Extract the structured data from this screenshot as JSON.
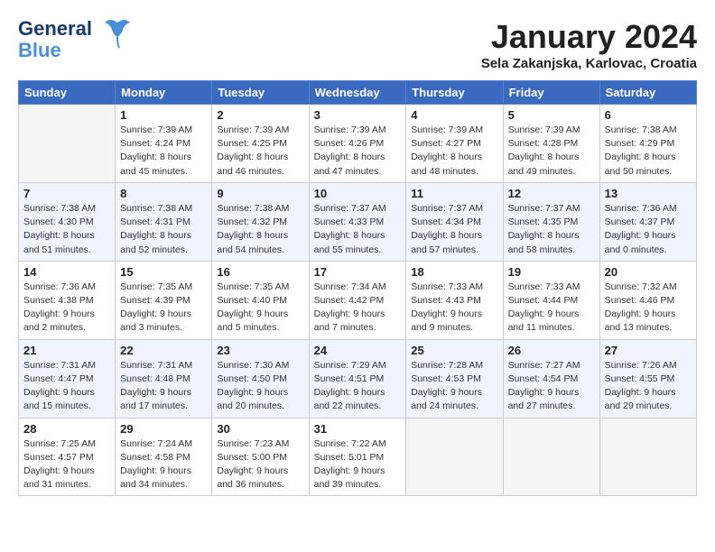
{
  "header": {
    "logo_line1": "General",
    "logo_line2": "Blue",
    "month": "January 2024",
    "location": "Sela Zakanjska, Karlovac, Croatia"
  },
  "weekdays": [
    "Sunday",
    "Monday",
    "Tuesday",
    "Wednesday",
    "Thursday",
    "Friday",
    "Saturday"
  ],
  "weeks": [
    [
      {
        "day": "",
        "empty": true
      },
      {
        "day": "1",
        "sunrise": "7:39 AM",
        "sunset": "4:24 PM",
        "daylight": "8 hours and 45 minutes."
      },
      {
        "day": "2",
        "sunrise": "7:39 AM",
        "sunset": "4:25 PM",
        "daylight": "8 hours and 46 minutes."
      },
      {
        "day": "3",
        "sunrise": "7:39 AM",
        "sunset": "4:26 PM",
        "daylight": "8 hours and 47 minutes."
      },
      {
        "day": "4",
        "sunrise": "7:39 AM",
        "sunset": "4:27 PM",
        "daylight": "8 hours and 48 minutes."
      },
      {
        "day": "5",
        "sunrise": "7:39 AM",
        "sunset": "4:28 PM",
        "daylight": "8 hours and 49 minutes."
      },
      {
        "day": "6",
        "sunrise": "7:38 AM",
        "sunset": "4:29 PM",
        "daylight": "8 hours and 50 minutes."
      }
    ],
    [
      {
        "day": "7",
        "sunrise": "7:38 AM",
        "sunset": "4:30 PM",
        "daylight": "8 hours and 51 minutes."
      },
      {
        "day": "8",
        "sunrise": "7:38 AM",
        "sunset": "4:31 PM",
        "daylight": "8 hours and 52 minutes."
      },
      {
        "day": "9",
        "sunrise": "7:38 AM",
        "sunset": "4:32 PM",
        "daylight": "8 hours and 54 minutes."
      },
      {
        "day": "10",
        "sunrise": "7:37 AM",
        "sunset": "4:33 PM",
        "daylight": "8 hours and 55 minutes."
      },
      {
        "day": "11",
        "sunrise": "7:37 AM",
        "sunset": "4:34 PM",
        "daylight": "8 hours and 57 minutes."
      },
      {
        "day": "12",
        "sunrise": "7:37 AM",
        "sunset": "4:35 PM",
        "daylight": "8 hours and 58 minutes."
      },
      {
        "day": "13",
        "sunrise": "7:36 AM",
        "sunset": "4:37 PM",
        "daylight": "9 hours and 0 minutes."
      }
    ],
    [
      {
        "day": "14",
        "sunrise": "7:36 AM",
        "sunset": "4:38 PM",
        "daylight": "9 hours and 2 minutes."
      },
      {
        "day": "15",
        "sunrise": "7:35 AM",
        "sunset": "4:39 PM",
        "daylight": "9 hours and 3 minutes."
      },
      {
        "day": "16",
        "sunrise": "7:35 AM",
        "sunset": "4:40 PM",
        "daylight": "9 hours and 5 minutes."
      },
      {
        "day": "17",
        "sunrise": "7:34 AM",
        "sunset": "4:42 PM",
        "daylight": "9 hours and 7 minutes."
      },
      {
        "day": "18",
        "sunrise": "7:33 AM",
        "sunset": "4:43 PM",
        "daylight": "9 hours and 9 minutes."
      },
      {
        "day": "19",
        "sunrise": "7:33 AM",
        "sunset": "4:44 PM",
        "daylight": "9 hours and 11 minutes."
      },
      {
        "day": "20",
        "sunrise": "7:32 AM",
        "sunset": "4:46 PM",
        "daylight": "9 hours and 13 minutes."
      }
    ],
    [
      {
        "day": "21",
        "sunrise": "7:31 AM",
        "sunset": "4:47 PM",
        "daylight": "9 hours and 15 minutes."
      },
      {
        "day": "22",
        "sunrise": "7:31 AM",
        "sunset": "4:48 PM",
        "daylight": "9 hours and 17 minutes."
      },
      {
        "day": "23",
        "sunrise": "7:30 AM",
        "sunset": "4:50 PM",
        "daylight": "9 hours and 20 minutes."
      },
      {
        "day": "24",
        "sunrise": "7:29 AM",
        "sunset": "4:51 PM",
        "daylight": "9 hours and 22 minutes."
      },
      {
        "day": "25",
        "sunrise": "7:28 AM",
        "sunset": "4:53 PM",
        "daylight": "9 hours and 24 minutes."
      },
      {
        "day": "26",
        "sunrise": "7:27 AM",
        "sunset": "4:54 PM",
        "daylight": "9 hours and 27 minutes."
      },
      {
        "day": "27",
        "sunrise": "7:26 AM",
        "sunset": "4:55 PM",
        "daylight": "9 hours and 29 minutes."
      }
    ],
    [
      {
        "day": "28",
        "sunrise": "7:25 AM",
        "sunset": "4:57 PM",
        "daylight": "9 hours and 31 minutes."
      },
      {
        "day": "29",
        "sunrise": "7:24 AM",
        "sunset": "4:58 PM",
        "daylight": "9 hours and 34 minutes."
      },
      {
        "day": "30",
        "sunrise": "7:23 AM",
        "sunset": "5:00 PM",
        "daylight": "9 hours and 36 minutes."
      },
      {
        "day": "31",
        "sunrise": "7:22 AM",
        "sunset": "5:01 PM",
        "daylight": "9 hours and 39 minutes."
      },
      {
        "day": "",
        "empty": true
      },
      {
        "day": "",
        "empty": true
      },
      {
        "day": "",
        "empty": true
      }
    ]
  ]
}
